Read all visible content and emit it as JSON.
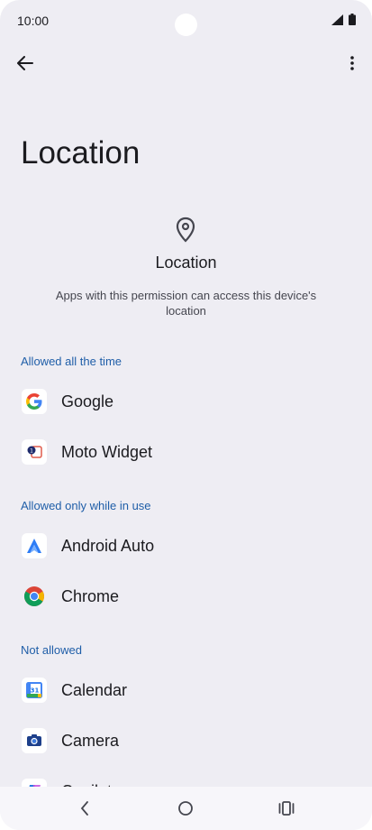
{
  "status": {
    "time": "10:00"
  },
  "page": {
    "title": "Location"
  },
  "header": {
    "title": "Location",
    "description": "Apps with this permission can access this device's location"
  },
  "sections": {
    "allowed_all": {
      "label": "Allowed all the time",
      "apps": [
        {
          "name": "Google",
          "icon": "google-icon"
        },
        {
          "name": "Moto Widget",
          "icon": "moto-widget-icon"
        }
      ]
    },
    "allowed_in_use": {
      "label": "Allowed only while in use",
      "apps": [
        {
          "name": "Android Auto",
          "icon": "android-auto-icon"
        },
        {
          "name": "Chrome",
          "icon": "chrome-icon"
        }
      ]
    },
    "not_allowed": {
      "label": "Not allowed",
      "apps": [
        {
          "name": "Calendar",
          "icon": "calendar-icon"
        },
        {
          "name": "Camera",
          "icon": "camera-icon"
        },
        {
          "name": "Copilot",
          "icon": "copilot-icon"
        }
      ]
    }
  },
  "colors": {
    "accent": "#1f5ea8",
    "background": "#eeedf3"
  }
}
